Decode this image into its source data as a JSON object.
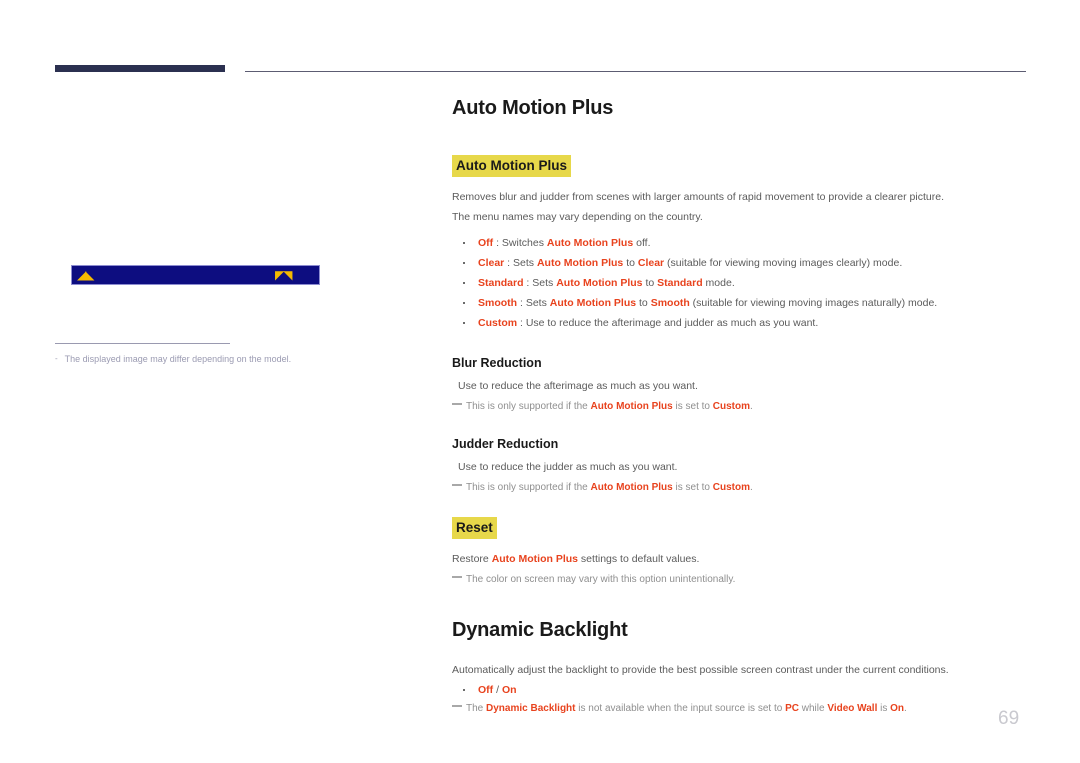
{
  "document": {
    "page_number": "69",
    "accent_keyword_color": "#e8431e",
    "highlight_color": "#e7d84a",
    "header_bar_color": "#2b3050"
  },
  "illustration": {
    "osd_bar": {
      "background_color": "#0d0d80",
      "border_color": "#8c8cd0",
      "glyph_color": "#f5ba00",
      "left_icon": "osd-menu-icon",
      "right_icon": "osd-lock-icon",
      "left_glyph": "◢◣",
      "right_glyph": "◤◥"
    },
    "caption_dash": "-",
    "caption": "The displayed image may differ depending on the model."
  },
  "content": {
    "page_title": "Auto Motion Plus",
    "sections": [
      {
        "id": "auto-motion-plus",
        "highlight_heading": "Auto Motion Plus",
        "paragraphs": [
          "Removes blur and judder from scenes with larger amounts of rapid movement to provide a clearer picture.",
          "The menu names may vary depending on the country."
        ],
        "bullets": [
          {
            "keyword": "Off",
            "text": " : Switches ",
            "keyword2": "Auto Motion Plus",
            "text2": " off."
          },
          {
            "keyword": "Clear",
            "text": " : Sets ",
            "keyword2": "Auto Motion Plus",
            "text2": " to ",
            "keyword3": "Clear",
            "text3": " (suitable for viewing moving images clearly) mode."
          },
          {
            "keyword": "Standard",
            "text": " : Sets ",
            "keyword2": "Auto Motion Plus",
            "text2": " to ",
            "keyword3": "Standard",
            "text3": " mode."
          },
          {
            "keyword": "Smooth",
            "text": " : Sets ",
            "keyword2": "Auto Motion Plus",
            "text2": " to ",
            "keyword3": "Smooth",
            "text3": " (suitable for viewing moving images naturally) mode."
          },
          {
            "keyword": "Custom",
            "text": " : Use to reduce the afterimage and judder as much as you want."
          }
        ]
      },
      {
        "id": "blur-reduction",
        "sub_heading": "Blur Reduction",
        "paragraph": "Use to reduce the afterimage as much as you want.",
        "note": {
          "lead": "This is only supported if the ",
          "kw1": "Auto Motion Plus",
          "mid": " is set to ",
          "kw2": "Custom",
          "tail": "."
        }
      },
      {
        "id": "judder-reduction",
        "sub_heading": "Judder Reduction",
        "paragraph": "Use to reduce the judder as much as you want.",
        "note": {
          "lead": "This is only supported if the ",
          "kw1": "Auto Motion Plus",
          "mid": " is set to ",
          "kw2": "Custom",
          "tail": "."
        }
      },
      {
        "id": "reset",
        "highlight_heading": "Reset",
        "paragraph_lead": "Restore ",
        "paragraph_kw": "Auto Motion Plus",
        "paragraph_tail": " settings to default values.",
        "note_text": "The color on screen may vary with this option unintentionally."
      },
      {
        "id": "dynamic-backlight",
        "title": "Dynamic Backlight",
        "paragraph": "Automatically adjust the backlight to provide the best possible screen contrast under the current conditions.",
        "bullet_off": "Off",
        "bullet_sep": " / ",
        "bullet_on": "On",
        "note": {
          "lead": "The ",
          "kw1": "Dynamic Backlight",
          "mid1": " is not available when the input source is set to ",
          "kw2": "PC",
          "mid2": " while ",
          "kw3": "Video Wall",
          "mid3": " is ",
          "kw4": "On",
          "tail": "."
        }
      }
    ]
  }
}
